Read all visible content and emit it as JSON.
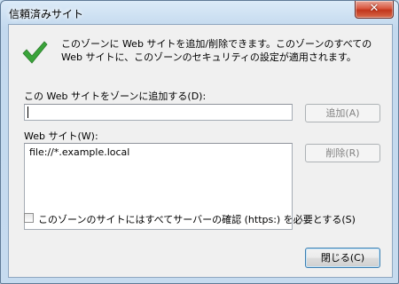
{
  "window": {
    "title": "信頼済みサイト",
    "close_glyph": "✕"
  },
  "intro": {
    "text": "このゾーンに Web サイトを追加/削除できます。このゾーンのすべての Web サイトに、このゾーンのセキュリティの設定が適用されます。"
  },
  "add_section": {
    "label": "この Web サイトをゾーンに追加する(D):",
    "input_value": "",
    "add_button": "追加(A)"
  },
  "sites_section": {
    "label": "Web サイト(W):",
    "items": [
      "file://*.example.local"
    ],
    "remove_button": "削除(R)"
  },
  "require_https": {
    "label": "このゾーンのサイトにはすべてサーバーの確認 (https:) を必要とする(S)",
    "checked": false
  },
  "footer": {
    "close_button": "閉じる(C)"
  },
  "colors": {
    "check_green": "#3aa43a",
    "titlebar": "#c6dbef",
    "dialog_bg": "#f0f0f0"
  }
}
